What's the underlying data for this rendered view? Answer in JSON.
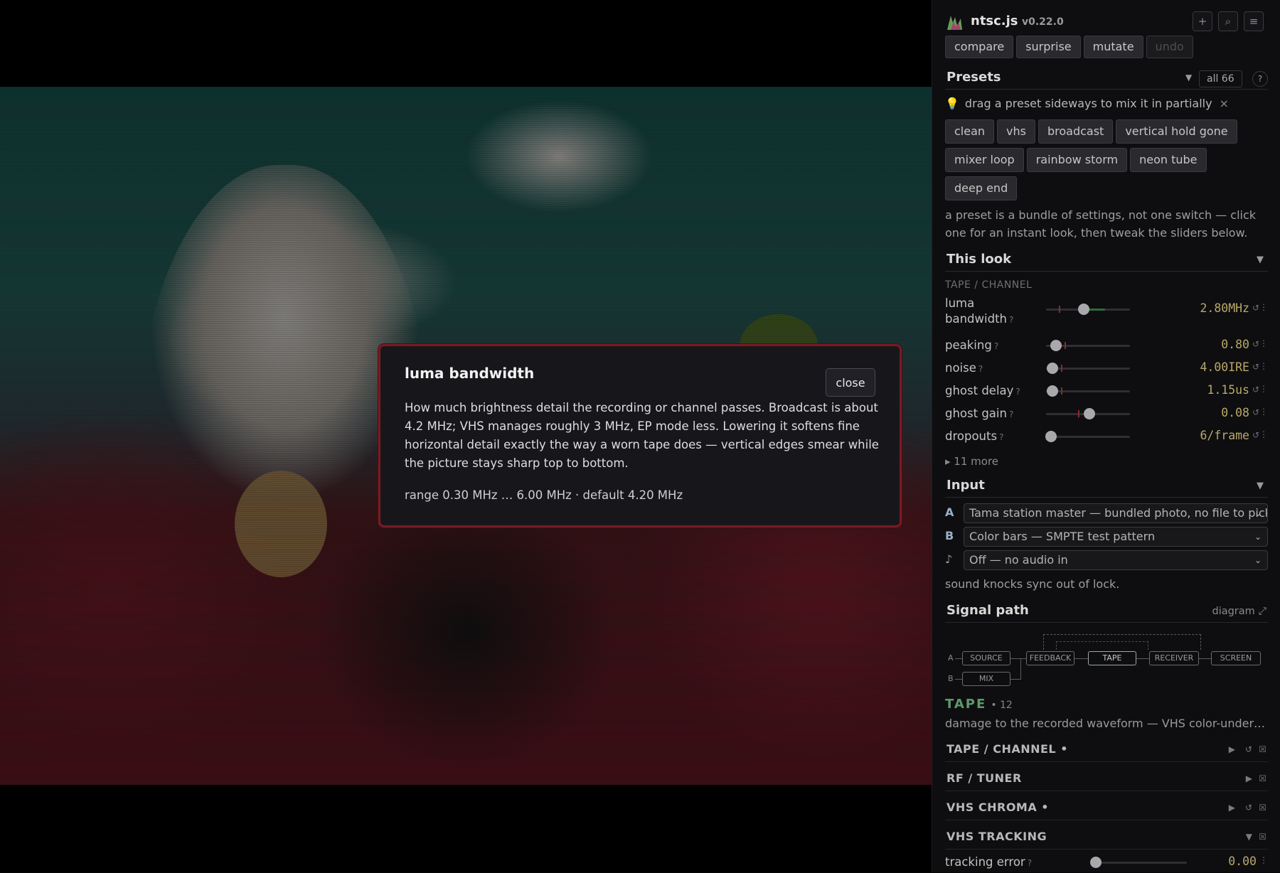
{
  "app": {
    "name": "ntsc.js",
    "version": "v0.22.0"
  },
  "toolbar": {
    "compare": "compare",
    "surprise": "surprise",
    "mutate": "mutate",
    "undo": "undo"
  },
  "header_icons": [
    "crosshair-icon",
    "search-icon",
    "menu-icon"
  ],
  "presets": {
    "title": "Presets",
    "filter": "all 66",
    "help": "?",
    "tip": "drag a preset sideways to mix it in partially",
    "tip_close": "×",
    "items": [
      "clean",
      "vhs",
      "broadcast",
      "vertical hold gone",
      "mixer loop",
      "rainbow storm",
      "neon tube",
      "deep end"
    ],
    "description": "a preset is a bundle of settings, not one switch — click one for an instant look, then tweak the sliders below."
  },
  "this_look": {
    "title": "This look",
    "group": "TAPE / CHANNEL",
    "sliders": [
      {
        "label": "luma bandwidth",
        "value": "2.80MHz",
        "pos": 0.45,
        "def": 0.15
      },
      {
        "label": "peaking",
        "value": "0.80",
        "pos": 0.12,
        "def": 0.22
      },
      {
        "label": "noise",
        "value": "4.00IRE",
        "pos": 0.08,
        "def": 0.18
      },
      {
        "label": "ghost delay",
        "value": "1.15us",
        "pos": 0.08,
        "def": 0.18
      },
      {
        "label": "ghost gain",
        "value": "0.08",
        "pos": 0.52,
        "def": 0.38
      },
      {
        "label": "dropouts",
        "value": "6/frame",
        "pos": 0.06,
        "def": 0.0
      }
    ],
    "more": "▸ 11 more",
    "help_mark": "?",
    "reset_mark": "↺",
    "menu_mark": "⋮"
  },
  "input": {
    "title": "Input",
    "a_key": "A",
    "a_value": "Tama station master — bundled photo, no file to pick",
    "b_key": "B",
    "b_value": "Color bars — SMPTE test pattern",
    "audio_key": "♪",
    "audio_value": "Off — no audio in",
    "note": "sound knocks sync out of lock."
  },
  "signal_path": {
    "title": "Signal path",
    "diagram_link": "diagram ⤢",
    "row_a": "A",
    "row_b": "B",
    "nodes": {
      "source": "SOURCE",
      "mix": "MIX",
      "feedback": "FEEDBACK",
      "tape": "TAPE",
      "receiver": "RECEIVER",
      "screen": "SCREEN"
    },
    "active": "TAPE",
    "active_count": "• 12",
    "active_desc": "damage to the recorded waveform — VHS color-under, dropouts and tracking"
  },
  "sections": [
    {
      "label": "TAPE / CHANNEL •"
    },
    {
      "label": "RF / TUNER"
    },
    {
      "label": "VHS CHROMA •"
    },
    {
      "label": "VHS TRACKING"
    }
  ],
  "tracking": {
    "label": "tracking error",
    "value": "0.00",
    "pos": 0.0
  },
  "modal": {
    "title": "luma bandwidth",
    "close": "close",
    "body": "How much brightness detail the recording or channel passes. Broadcast is about 4.2 MHz; VHS manages roughly 3 MHz, EP mode less. Lowering it softens fine horizontal detail exactly the way a worn tape does — vertical edges smear while the picture stays sharp top to bottom.",
    "range": "range 0.30 MHz … 6.00 MHz · default 4.20 MHz"
  },
  "colors": {
    "accent_green": "#5e9a6a",
    "value_text": "#b9a86a",
    "modal_border": "#7a1a22"
  }
}
